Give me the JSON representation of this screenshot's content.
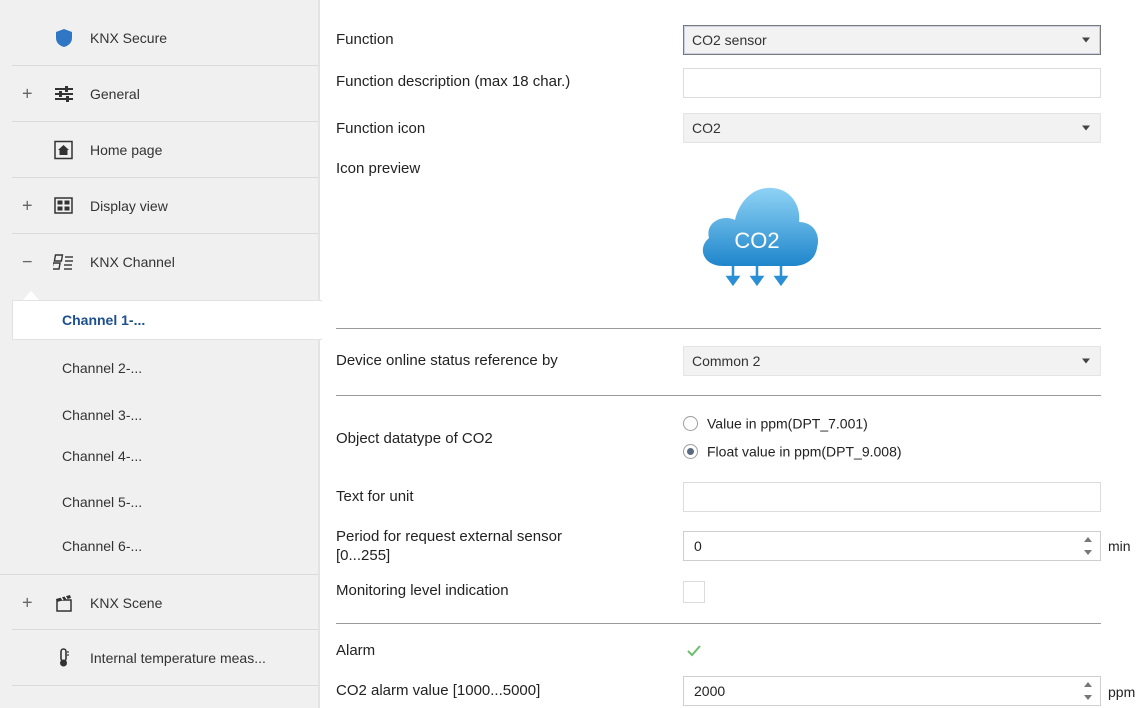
{
  "sidebar": {
    "items": [
      {
        "label": "KNX Secure",
        "icon": "shield-icon",
        "expander": ""
      },
      {
        "label": "General",
        "icon": "sliders-icon",
        "expander": "+"
      },
      {
        "label": "Home page",
        "icon": "home-icon",
        "expander": ""
      },
      {
        "label": "Display view",
        "icon": "grid-icon",
        "expander": "+"
      },
      {
        "label": "KNX Channel",
        "icon": "channel-icon",
        "expander": "−"
      }
    ],
    "channels": [
      "Channel 1-...",
      "Channel 2-...",
      "Channel 3-...",
      "Channel 4-...",
      "Channel 5-...",
      "Channel 6-..."
    ],
    "bottom_items": [
      {
        "label": "KNX Scene",
        "icon": "scene-icon",
        "expander": "+"
      },
      {
        "label": "Internal temperature meas...",
        "icon": "thermometer-icon",
        "expander": ""
      }
    ]
  },
  "form": {
    "function": {
      "label": "Function",
      "value": "CO2 sensor"
    },
    "description": {
      "label": "Function description (max 18 char.)",
      "value": ""
    },
    "icon": {
      "label": "Function icon",
      "value": "CO2"
    },
    "preview": {
      "label": "Icon preview",
      "icon_text": "CO2"
    },
    "online_status": {
      "label": "Device online status reference by",
      "value": "Common 2"
    },
    "datatype": {
      "label": "Object datatype of CO2",
      "options": [
        "Value in ppm(DPT_7.001)",
        "Float value in ppm(DPT_9.008)"
      ],
      "selected": 1
    },
    "unit_text": {
      "label": "Text for unit",
      "value": ""
    },
    "period": {
      "label_line1": "Period for request external sensor",
      "label_line2": "[0...255]",
      "value": "0",
      "unit": "min"
    },
    "monitoring": {
      "label": "Monitoring level indication",
      "checked": false
    },
    "alarm": {
      "label": "Alarm",
      "checked": true
    },
    "alarm_value": {
      "label": "CO2 alarm value [1000...5000]",
      "value": "2000",
      "unit": "ppm"
    }
  },
  "colors": {
    "accent_active": "#1d4e8f",
    "cloud": "#3aa3dd",
    "check": "#5cb85c"
  }
}
